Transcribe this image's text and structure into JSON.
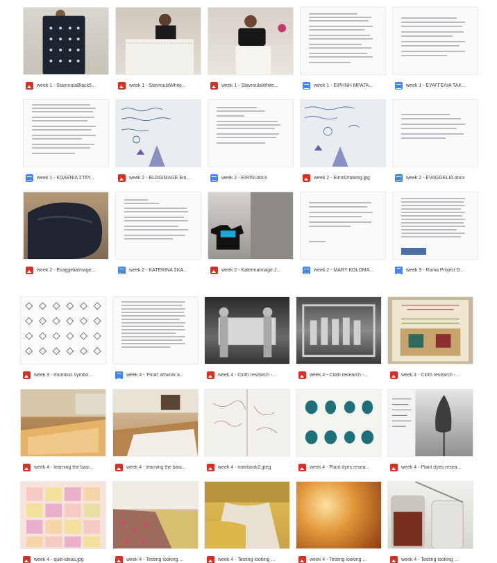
{
  "colors": {
    "image_icon": "#d93025",
    "doc_icon": "#4285f4",
    "caption_text": "#3c4043"
  },
  "files": [
    {
      "name": "week 1 - StavroulaBlack5...",
      "type": "image"
    },
    {
      "name": "week 1 - StavroulaWhite...",
      "type": "image"
    },
    {
      "name": "week 1 - StavroulaWhite...",
      "type": "image"
    },
    {
      "name": "week 1 - ΕΙΡΗΝΗ ΜΡΑΓΑ...",
      "type": "doc"
    },
    {
      "name": "week 1 - ΕΥΑΓΓΕΛΙΑ ΤΑΚ...",
      "type": "doc"
    },
    {
      "name": "week 1 - ΚΟΑΕΝΙΑ ΣΤΑΥ...",
      "type": "doc"
    },
    {
      "name": "week 2 - BLOGIMAGE Eiri...",
      "type": "image"
    },
    {
      "name": "week 2 - EIRINI.docx",
      "type": "doc"
    },
    {
      "name": "week 2 - EiriniDrawing.jpg",
      "type": "image"
    },
    {
      "name": "week 2 - EVAGGELIA.docx",
      "type": "doc"
    },
    {
      "name": "week 2 - EvaggeliaImage...",
      "type": "image"
    },
    {
      "name": "week 2 - KATERINA ΣΚΑ...",
      "type": "doc"
    },
    {
      "name": "week 2 - KaterinaImage.J...",
      "type": "image"
    },
    {
      "name": "week 2 - MARY KOLOMA...",
      "type": "doc"
    },
    {
      "name": "week 3 - Roma Project O...",
      "type": "gdoc"
    },
    {
      "name": "week 3 - rhombus symbo...",
      "type": "image"
    },
    {
      "name": "week 4 - 'Final' artwork a...",
      "type": "gdoc"
    },
    {
      "name": "week 4 - Cloth research -...",
      "type": "image"
    },
    {
      "name": "week 4 - Cloth research -...",
      "type": "image"
    },
    {
      "name": "week 4 - Cloth research -...",
      "type": "image"
    },
    {
      "name": "week 4 - learning the basi...",
      "type": "image"
    },
    {
      "name": "week 4 - learning the basi...",
      "type": "image"
    },
    {
      "name": "week 4 - notebook2.jpeg",
      "type": "image"
    },
    {
      "name": "week 4 - Plant dyes resea...",
      "type": "image"
    },
    {
      "name": "week 4 - Plant dyes resea...",
      "type": "image"
    },
    {
      "name": "week 4 - quilt-ideas.jpg",
      "type": "image"
    },
    {
      "name": "week 4 - Testing looking ...",
      "type": "image"
    },
    {
      "name": "week 4 - Testing looking ...",
      "type": "image"
    },
    {
      "name": "week 4 - Testing looking ...",
      "type": "image"
    },
    {
      "name": "week 4 - Testing looking ...",
      "type": "image"
    }
  ]
}
